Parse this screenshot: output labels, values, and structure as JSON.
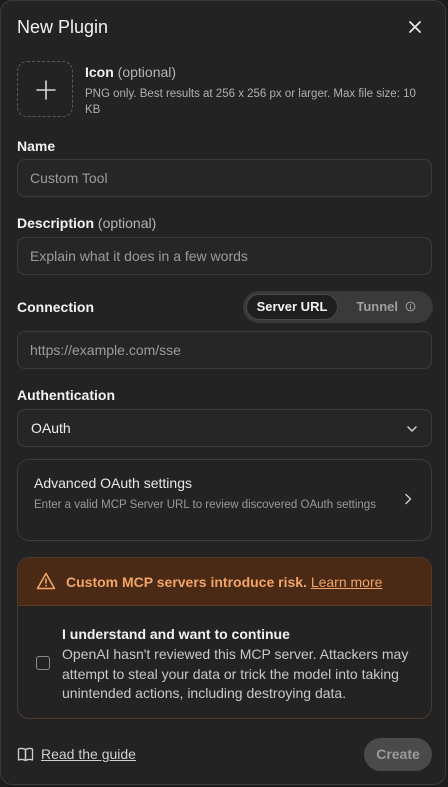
{
  "dialog": {
    "title": "New Plugin"
  },
  "icon_field": {
    "label": "Icon",
    "optional": "(optional)",
    "hint": "PNG only. Best results at 256 x 256 px or larger. Max file size: 10 KB"
  },
  "name_field": {
    "label": "Name",
    "placeholder": "Custom Tool"
  },
  "description_field": {
    "label": "Description",
    "optional": "(optional)",
    "placeholder": "Explain what it does in a few words"
  },
  "connection": {
    "label": "Connection",
    "tabs": [
      "Server URL",
      "Tunnel"
    ],
    "selected": "Server URL",
    "placeholder": "https://example.com/sse"
  },
  "authentication": {
    "label": "Authentication",
    "value": "OAuth"
  },
  "advanced_oauth": {
    "title": "Advanced OAuth settings",
    "description": "Enter a valid MCP Server URL to review discovered OAuth settings"
  },
  "warning": {
    "text": "Custom MCP servers introduce risk.",
    "link": "Learn more",
    "accent": "#f2a469",
    "consent_title": "I understand and want to continue",
    "consent_body": "OpenAI hasn't reviewed this MCP server. Attackers may attempt to steal your data or trick the model into taking unintended actions, including destroying data.",
    "checked": false
  },
  "footer": {
    "guide_link": "Read the guide",
    "create_label": "Create"
  }
}
